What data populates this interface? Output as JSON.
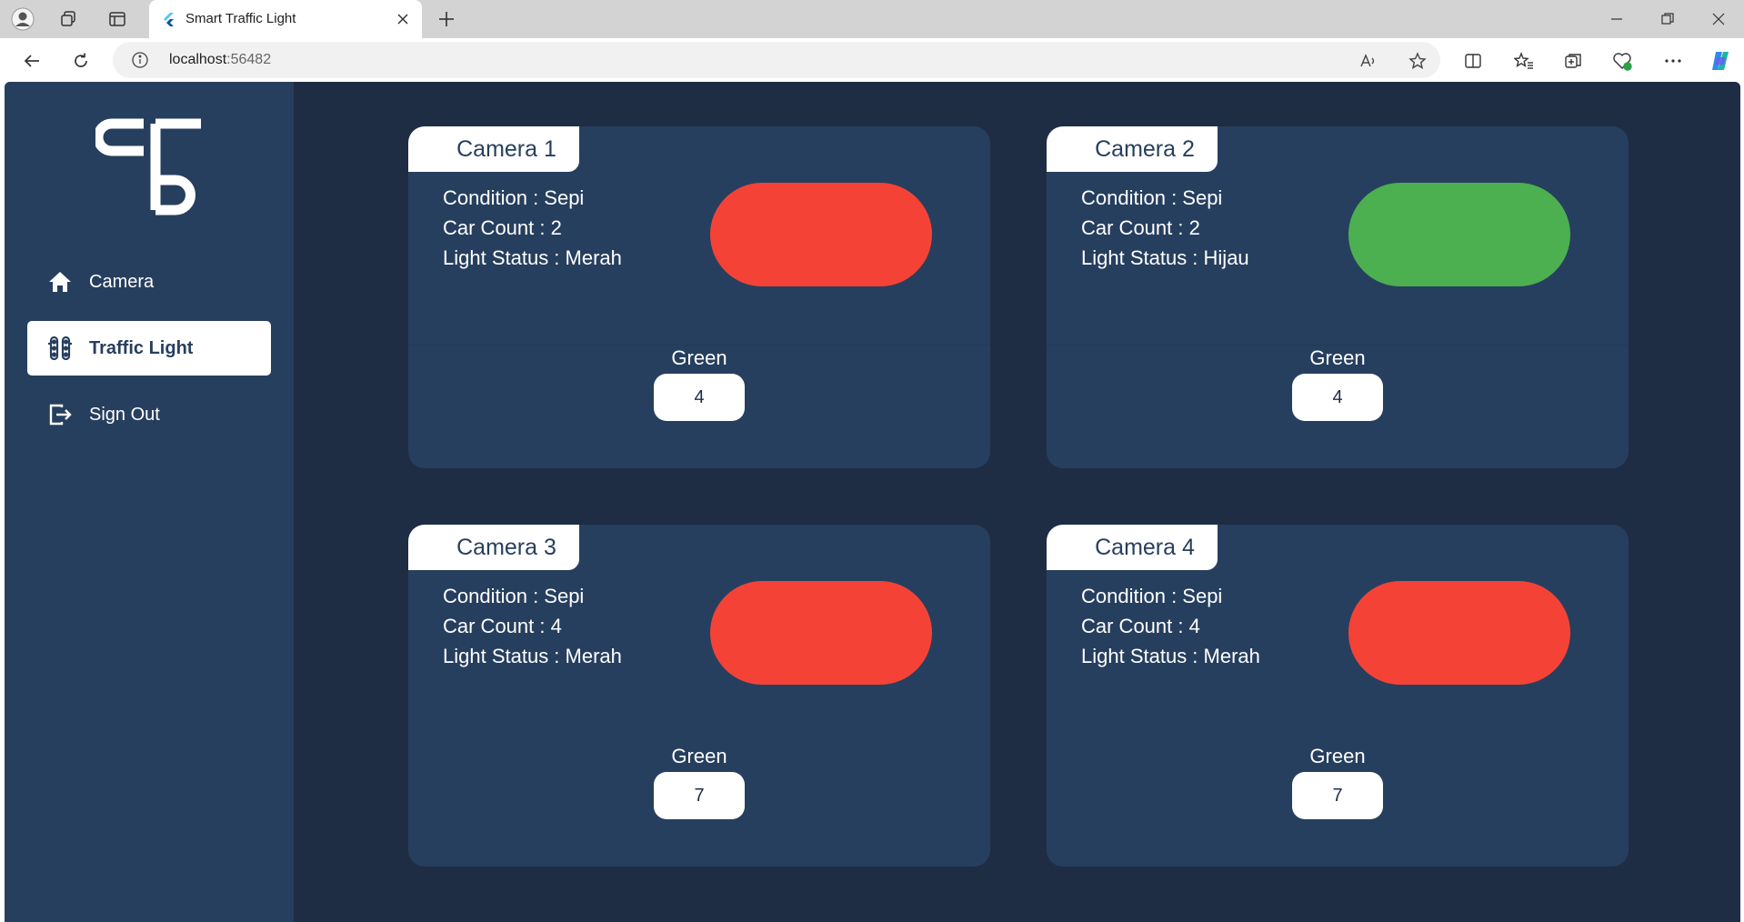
{
  "browser": {
    "tab_title": "Smart Traffic Light",
    "address_host": "localhost",
    "address_port": ":56482"
  },
  "sidebar": {
    "items": [
      {
        "label": "Camera",
        "icon": "home-icon"
      },
      {
        "label": "Traffic Light",
        "icon": "traffic-light-icon",
        "active": true
      },
      {
        "label": "Sign Out",
        "icon": "sign-out-icon"
      }
    ]
  },
  "cameras": [
    {
      "title": "Camera 1",
      "condition": "Condition : Sepi",
      "car_count": "Car Count : 2",
      "light_status": "Light Status : Merah",
      "light_color": "#f44336",
      "green_label": "Green",
      "green_value": "4"
    },
    {
      "title": "Camera 2",
      "condition": "Condition : Sepi",
      "car_count": "Car Count : 2",
      "light_status": "Light Status : Hijau",
      "light_color": "#4caf50",
      "green_label": "Green",
      "green_value": "4"
    },
    {
      "title": "Camera 3",
      "condition": "Condition : Sepi",
      "car_count": "Car Count : 4",
      "light_status": "Light Status : Merah",
      "light_color": "#f44336",
      "green_label": "Green",
      "green_value": "7"
    },
    {
      "title": "Camera 4",
      "condition": "Condition : Sepi",
      "car_count": "Car Count : 4",
      "light_status": "Light Status : Merah",
      "light_color": "#f44336",
      "green_label": "Green",
      "green_value": "7"
    }
  ],
  "colors": {
    "background": "#1e2d44",
    "panel": "#273f5e",
    "red": "#f44336",
    "green": "#4caf50"
  }
}
